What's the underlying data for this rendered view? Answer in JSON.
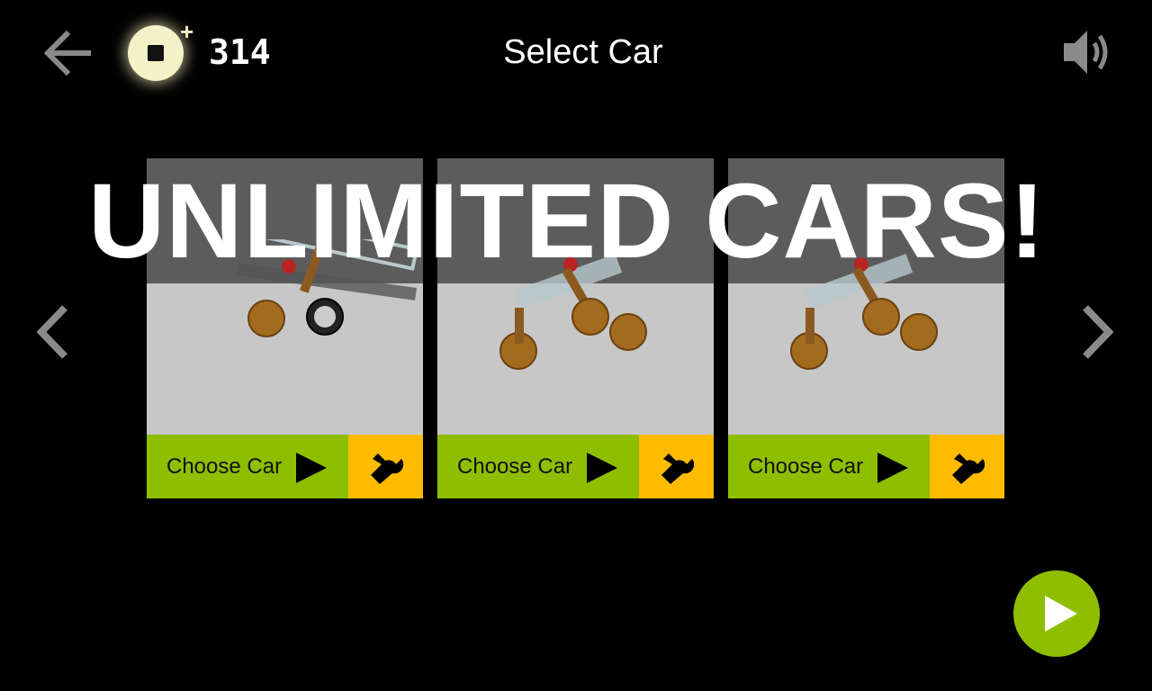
{
  "header": {
    "title": "Select Car",
    "coin_count": "314",
    "coin_plus": "+"
  },
  "banner": {
    "text": "UNLIMITED CARS!"
  },
  "cars": [
    {
      "choose_label": "Choose Car"
    },
    {
      "choose_label": "Choose Car"
    },
    {
      "choose_label": "Choose Car"
    }
  ],
  "colors": {
    "background": "#000000",
    "card_bg": "#c7c7c7",
    "card_top": "#5c5c5c",
    "choose_button": "#8fbe00",
    "edit_button": "#ffbb00",
    "play_button": "#8fbe00",
    "coin": "#f4f0c8"
  },
  "icons": {
    "back": "arrow-left-icon",
    "coin": "coin-icon",
    "sound": "speaker-icon",
    "prev": "chevron-left-icon",
    "next": "chevron-right-icon",
    "choose": "play-triangle-icon",
    "edit": "wrench-icon",
    "start": "play-icon"
  }
}
